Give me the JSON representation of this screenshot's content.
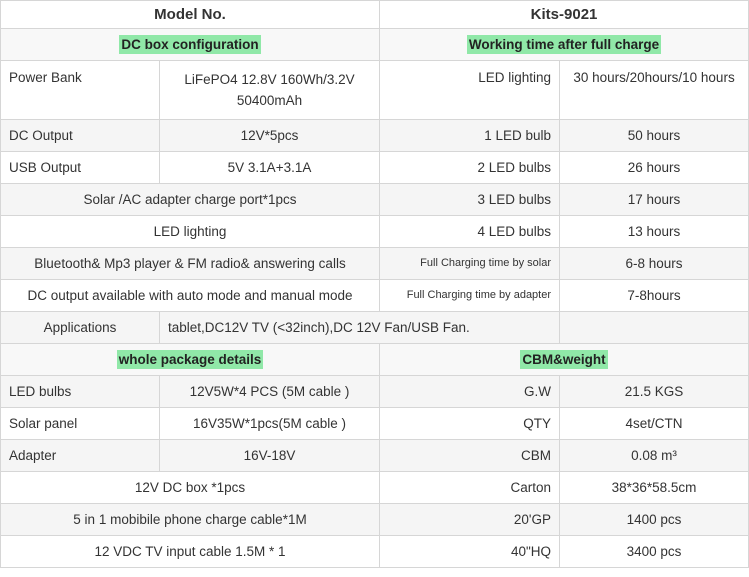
{
  "header": {
    "col1": "Model No.",
    "col2": "Kits-9021"
  },
  "sections": {
    "dc_box": "DC box configuration",
    "working_time": "Working time after full charge",
    "package": "whole package details",
    "cbm": "CBM&weight"
  },
  "rows": {
    "power_bank": {
      "label": "Power Bank",
      "value": "LiFePO4 12.8V 160Wh/3.2V 50400mAh",
      "right_label": "LED lighting",
      "right_value": "30 hours/20hours/10 hours"
    },
    "dc_output": {
      "label": "DC Output",
      "value": "12V*5pcs",
      "right_label": "1 LED bulb",
      "right_value": "50 hours"
    },
    "usb_output": {
      "label": "USB Output",
      "value": "5V  3.1A+3.1A",
      "right_label": "2 LED bulbs",
      "right_value": "26 hours"
    },
    "solar_port": {
      "value": "Solar /AC adapter charge port*1pcs",
      "right_label": "3 LED bulbs",
      "right_value": "17 hours"
    },
    "led_lighting": {
      "value": "LED lighting",
      "right_label": "4 LED bulbs",
      "right_value": "13 hours"
    },
    "bluetooth": {
      "value": "Bluetooth& Mp3 player & FM radio& answering calls",
      "right_label": "Full Charging time by solar",
      "right_value": "6-8 hours"
    },
    "dc_mode": {
      "value": "DC output available with auto mode and manual mode",
      "right_label": "Full Charging time by adapter",
      "right_value": "7-8hours"
    },
    "applications": {
      "label": "Applications",
      "value": "tablet,DC12V TV (<32inch),DC 12V Fan/USB Fan.",
      "right_value": ""
    },
    "led_bulbs": {
      "label": "LED bulbs",
      "value": "12V5W*4 PCS (5M cable )",
      "right_label": "G.W",
      "right_value": "21.5 KGS"
    },
    "solar_panel": {
      "label": "Solar panel",
      "value": "16V35W*1pcs(5M cable )",
      "right_label": "QTY",
      "right_value": "4set/CTN"
    },
    "adapter": {
      "label": "Adapter",
      "value": "16V-18V",
      "right_label": "CBM",
      "right_value": "0.08 m³"
    },
    "dc_box": {
      "value": "12V DC box *1pcs",
      "right_label": "Carton",
      "right_value": "38*36*58.5cm"
    },
    "cable5in1": {
      "value": "5 in 1 mobibile phone charge cable*1M",
      "right_label": "20'GP",
      "right_value": "1400 pcs"
    },
    "tv_cable": {
      "value": "12 VDC TV input cable 1.5M * 1",
      "right_label": "40\"HQ",
      "right_value": "3400 pcs"
    }
  },
  "colors": {
    "highlight": "#90e8a8",
    "border": "#d6d6d6",
    "alt_row": "#f5f5f5",
    "accent_bar": "#2a62d9"
  }
}
